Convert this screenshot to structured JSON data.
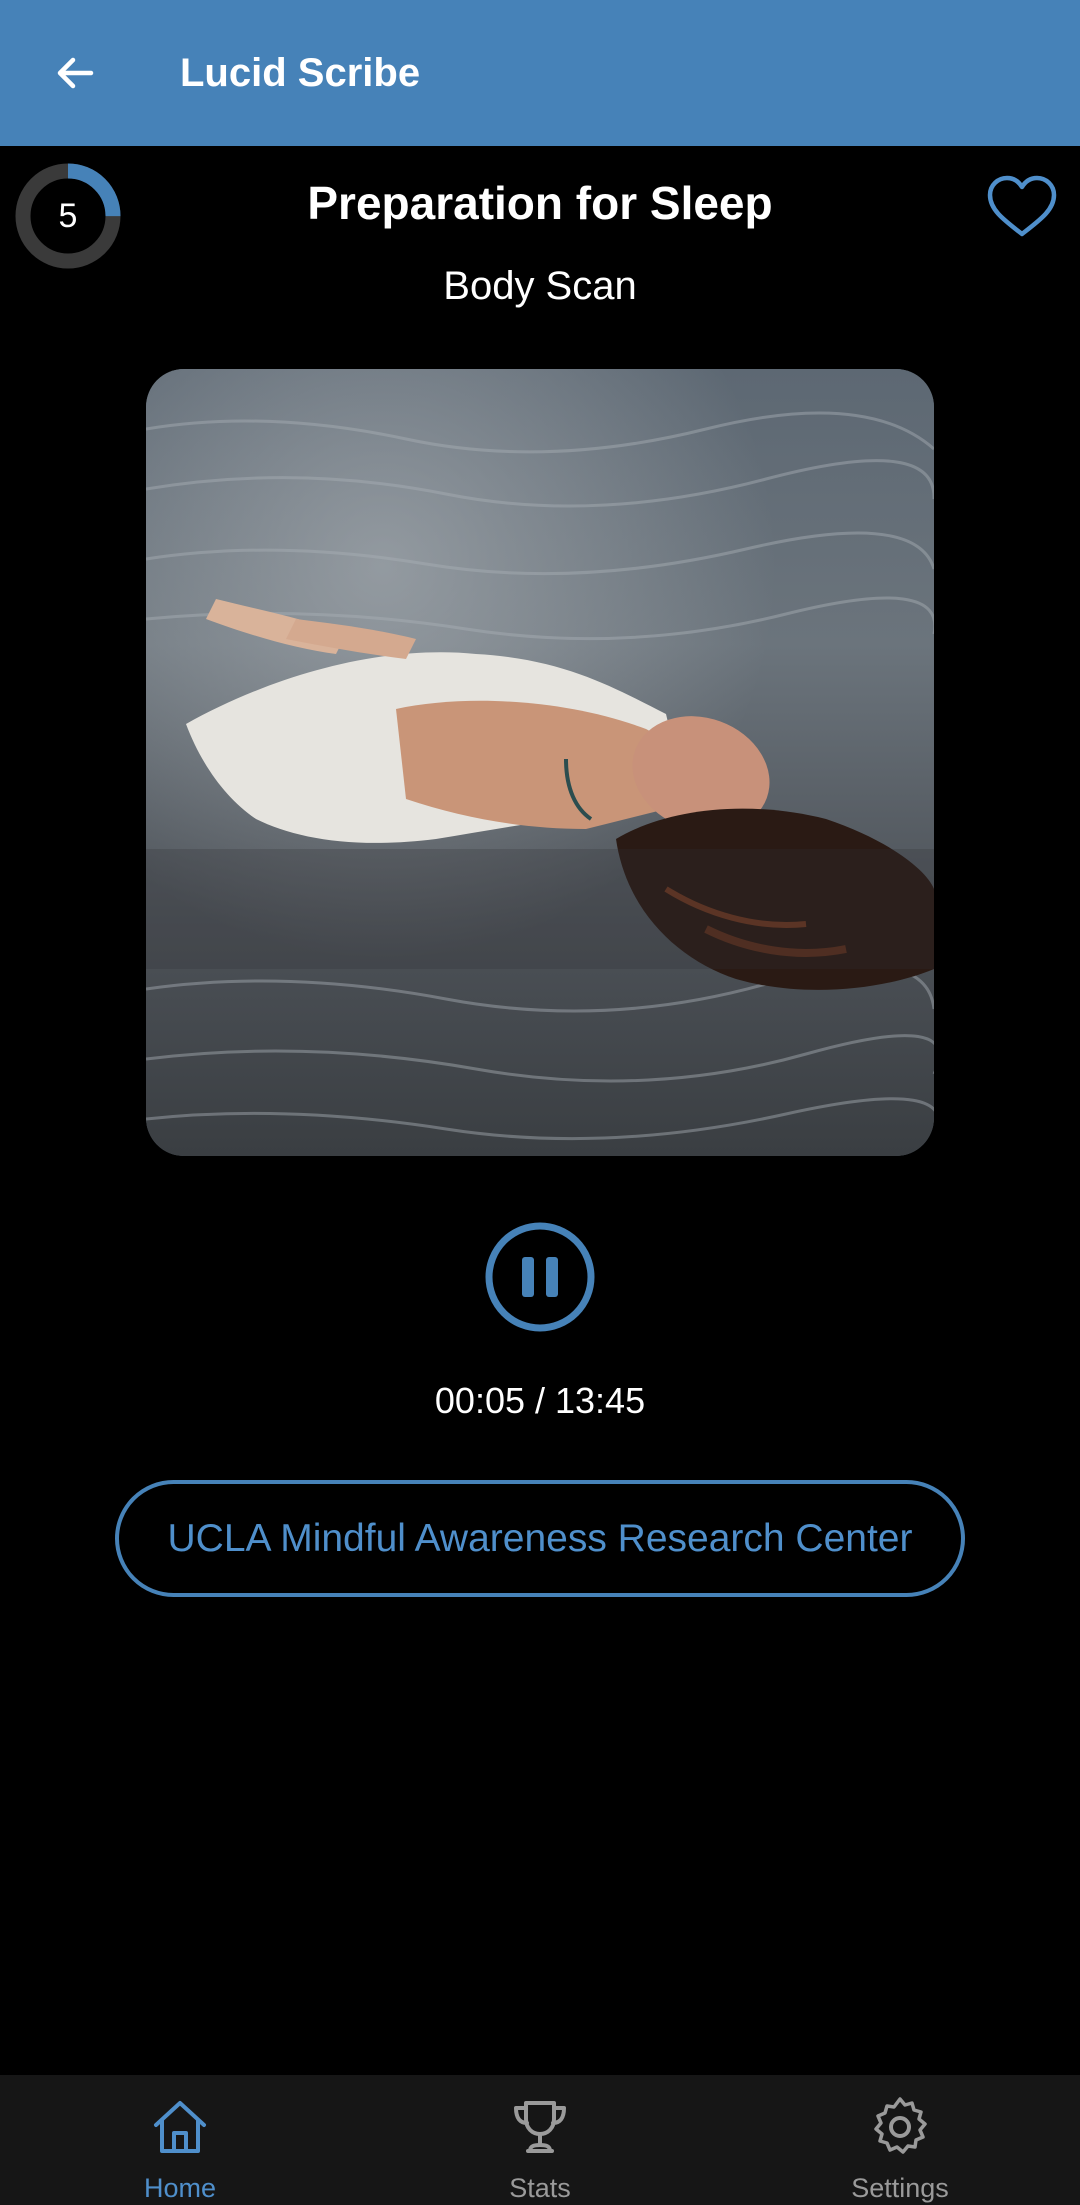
{
  "app_bar": {
    "title": "Lucid Scribe",
    "back_icon": "arrow-left-icon",
    "background_color": "#4682b8"
  },
  "session": {
    "streak_count": "5",
    "streak_progress": 0.25,
    "title": "Preparation for Sleep",
    "subtitle": "Body Scan",
    "favorite_icon": "heart-outline-icon",
    "artwork_icon": "woman-floating-in-water-photo"
  },
  "player": {
    "state_icon": "pause-icon",
    "time": "00:05 / 13:45"
  },
  "source": {
    "label": "UCLA Mindful Awareness Research Center"
  },
  "bottom_nav": {
    "items": [
      {
        "label": "Home",
        "icon": "home-icon",
        "active": true
      },
      {
        "label": "Stats",
        "icon": "trophy-icon",
        "active": false
      },
      {
        "label": "Settings",
        "icon": "gear-icon",
        "active": false
      }
    ],
    "active_color": "#4f8fcb",
    "inactive_color": "#9a9a9a"
  }
}
